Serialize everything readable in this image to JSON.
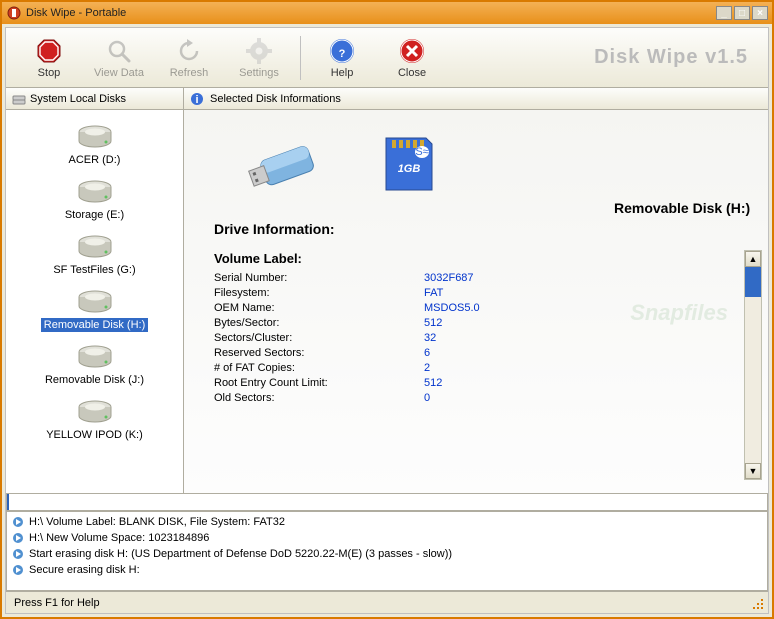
{
  "window": {
    "title": "Disk Wipe  - Portable"
  },
  "brand": "Disk Wipe v1.5",
  "toolbar": {
    "stop": "Stop",
    "viewdata": "View Data",
    "refresh": "Refresh",
    "settings": "Settings",
    "help": "Help",
    "close": "Close"
  },
  "sidebar": {
    "header": "System Local Disks",
    "disks": [
      {
        "label": "ACER (D:)",
        "selected": false
      },
      {
        "label": "Storage (E:)",
        "selected": false
      },
      {
        "label": "SF TestFiles (G:)",
        "selected": false
      },
      {
        "label": "Removable Disk (H:)",
        "selected": true
      },
      {
        "label": "Removable Disk (J:)",
        "selected": false
      },
      {
        "label": "YELLOW IPOD (K:)",
        "selected": false
      }
    ]
  },
  "main": {
    "header": "Selected Disk Informations",
    "selected_title": "Removable Disk  (H:)",
    "drive_info_title": "Drive Information:",
    "volume_label_title": "Volume Label:",
    "rows": [
      {
        "k": "Serial Number:",
        "v": "3032F687"
      },
      {
        "k": "Filesystem:",
        "v": "FAT"
      },
      {
        "k": "OEM Name:",
        "v": "MSDOS5.0"
      },
      {
        "k": "Bytes/Sector:",
        "v": "512"
      },
      {
        "k": "Sectors/Cluster:",
        "v": "32"
      },
      {
        "k": "Reserved Sectors:",
        "v": "6"
      },
      {
        "k": "# of FAT Copies:",
        "v": "2"
      },
      {
        "k": "Root Entry Count Limit:",
        "v": "512"
      },
      {
        "k": "Old Sectors:",
        "v": "0"
      }
    ]
  },
  "log": [
    "H:\\ Volume Label: BLANK DISK, File System: FAT32",
    "H:\\ New Volume Space: 1023184896",
    "Start erasing disk H: (US Department of Defense DoD 5220.22-M(E) (3 passes - slow))",
    "Secure erasing disk H:"
  ],
  "status": "Press F1 for Help",
  "watermark": "Snapfiles"
}
